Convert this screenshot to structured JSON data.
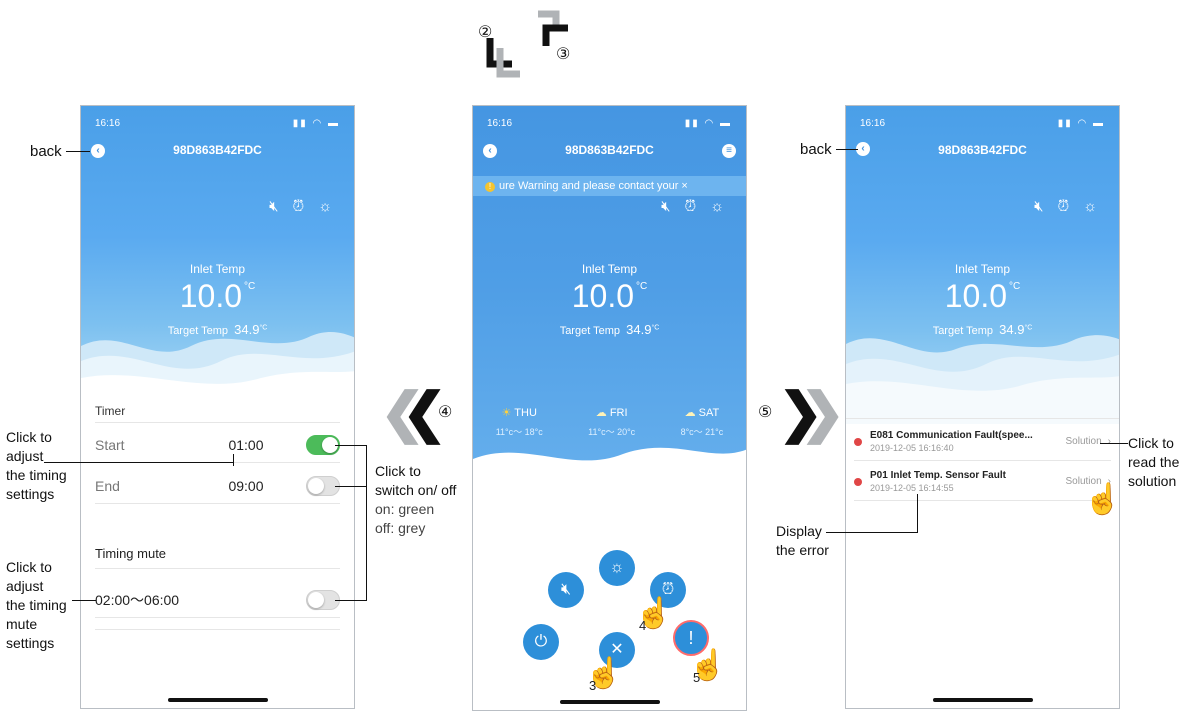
{
  "nav_labels": {
    "back": "back"
  },
  "step_numbers": {
    "s2": "②",
    "s3": "③",
    "s4": "④",
    "s5": "⑤",
    "h3": "3",
    "h4": "4",
    "h5": "5"
  },
  "device": {
    "time": "16:16",
    "status_icons": "▮▮ ◠ ▬",
    "id": "98D863B42FDC",
    "inlet_label": "Inlet Temp",
    "inlet_value": "10.0",
    "inlet_unit": "°C",
    "target_label": "Target Temp",
    "target_value": "34.9",
    "target_unit": "°C"
  },
  "timer_screen": {
    "timer_title": "Timer",
    "start_label": "Start",
    "start_value": "01:00",
    "start_on": true,
    "end_label": "End",
    "end_value": "09:00",
    "end_on": false,
    "mute_title": "Timing mute",
    "mute_range": "02:00～06:00",
    "mute_on": false
  },
  "home_screen": {
    "warning": "ure Warning and please contact your ×",
    "forecast": [
      {
        "day": "THU",
        "range": "11°c～ 18°c",
        "icon": "sun-icon"
      },
      {
        "day": "FRI",
        "range": "11°c～ 20°c",
        "icon": "cloud-sun-icon"
      },
      {
        "day": "SAT",
        "range": "8°c～ 21°c",
        "icon": "cloud-sun-icon"
      }
    ]
  },
  "fault_screen": {
    "faults": [
      {
        "name": "E081 Communication Fault(spee...",
        "time": "2019-12-05 16:16:40",
        "action": "Solution"
      },
      {
        "name": "P01 Inlet Temp. Sensor Fault",
        "time": "2019-12-05 16:14:55",
        "action": "Solution"
      }
    ]
  },
  "annotations": {
    "adjust_timing": [
      "Click to",
      "adjust",
      "the timing",
      "settings"
    ],
    "adjust_mute": [
      "Click to",
      "adjust",
      "the timing",
      "mute",
      "settings"
    ],
    "switch": [
      "Click to",
      "switch on/ off",
      "on: green",
      "off: grey"
    ],
    "read_solution": [
      "Click to",
      "read the",
      "solution"
    ],
    "display_error": [
      "Display",
      "the error"
    ]
  },
  "colors": {
    "sky": "#4a9fe8",
    "toggle_on": "#4cbb5a",
    "fab": "#2d8fd9",
    "fault_dot": "#e04646"
  }
}
